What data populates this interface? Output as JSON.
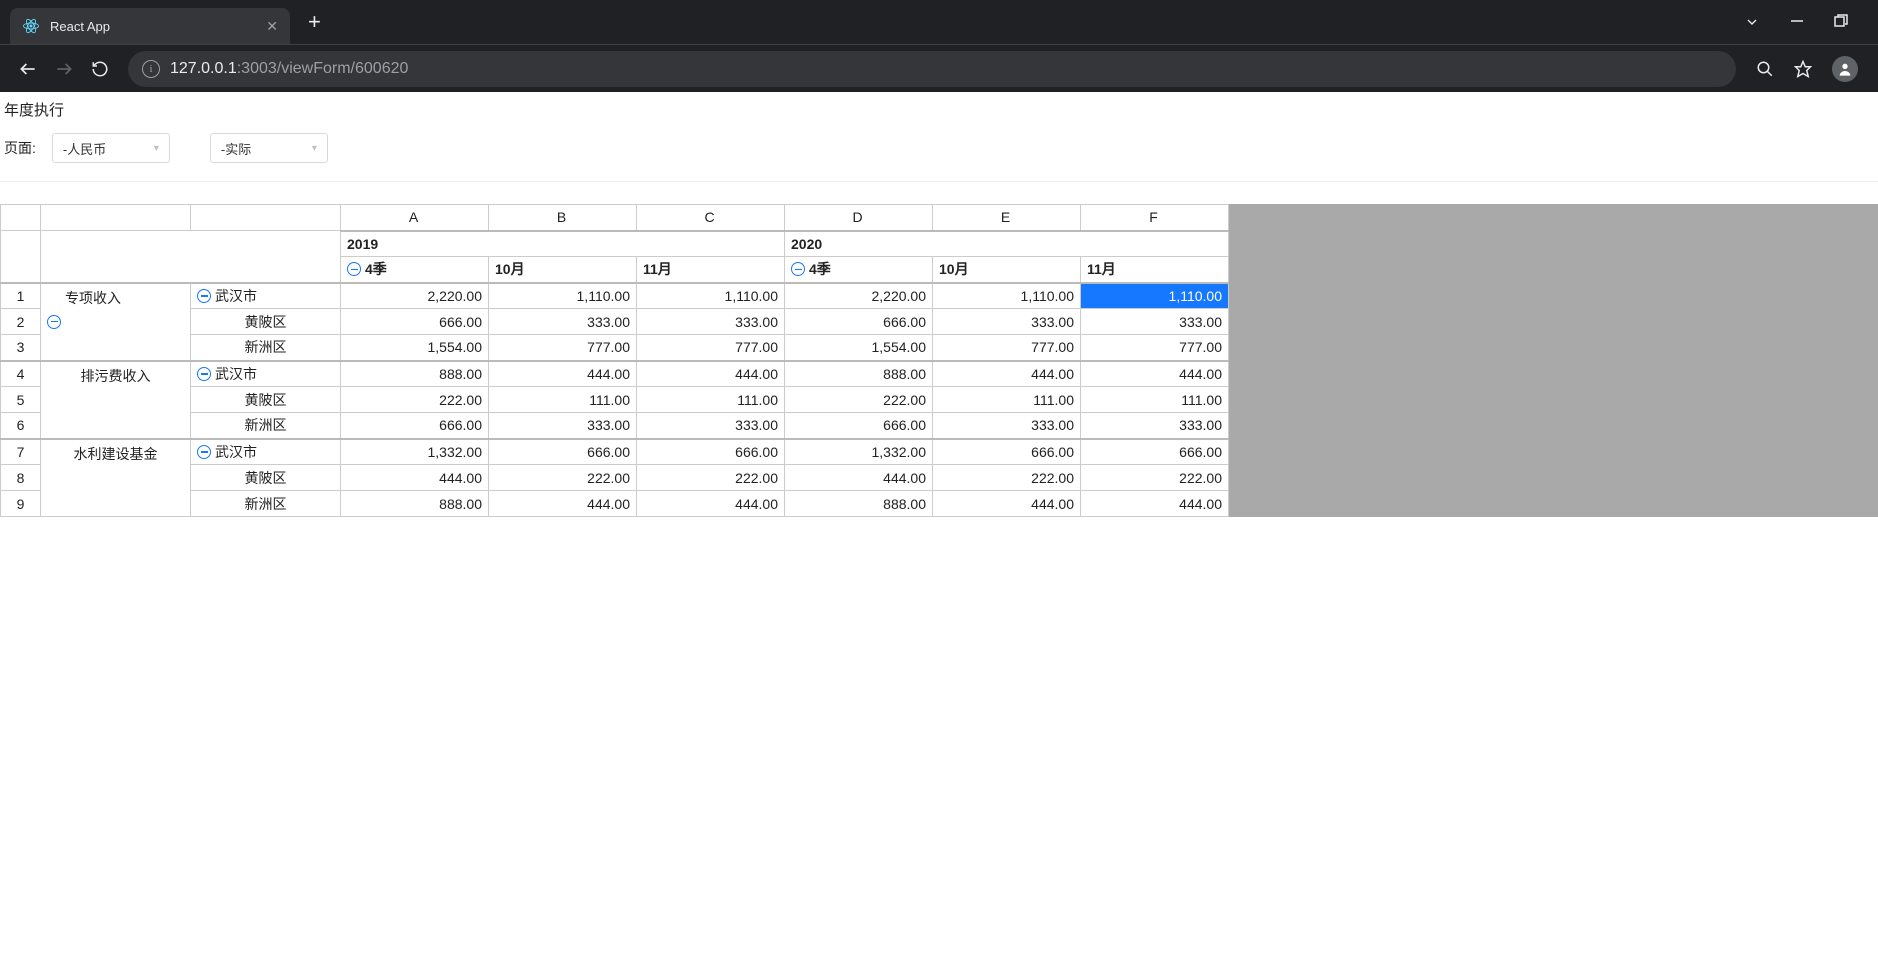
{
  "browser": {
    "tab_title": "React App",
    "url_host": "127.0.0.1",
    "url_path": ":3003/viewForm/600620"
  },
  "page": {
    "title": "年度执行",
    "page_label": "页面:",
    "select1": "-人民币",
    "select2": "-实际"
  },
  "grid": {
    "col_letters": [
      "A",
      "B",
      "C",
      "D",
      "E",
      "F"
    ],
    "years": {
      "y1": "2019",
      "y2": "2020"
    },
    "subcols": {
      "q4": "4季",
      "m10": "10月",
      "m11": "11月"
    },
    "categories": [
      {
        "name": "专项收入",
        "cities": [
          "武汉市",
          "黄陂区",
          "新洲区"
        ]
      },
      {
        "name": "排污费收入",
        "cities": [
          "武汉市",
          "黄陂区",
          "新洲区"
        ]
      },
      {
        "name": "水利建设基金",
        "cities": [
          "武汉市",
          "黄陂区",
          "新洲区"
        ]
      }
    ],
    "rows": [
      {
        "num": "1",
        "a": "2,220.00",
        "b": "1,110.00",
        "c": "1,110.00",
        "d": "2,220.00",
        "e": "1,110.00",
        "f": "1,110.00"
      },
      {
        "num": "2",
        "a": "666.00",
        "b": "333.00",
        "c": "333.00",
        "d": "666.00",
        "e": "333.00",
        "f": "333.00"
      },
      {
        "num": "3",
        "a": "1,554.00",
        "b": "777.00",
        "c": "777.00",
        "d": "1,554.00",
        "e": "777.00",
        "f": "777.00"
      },
      {
        "num": "4",
        "a": "888.00",
        "b": "444.00",
        "c": "444.00",
        "d": "888.00",
        "e": "444.00",
        "f": "444.00"
      },
      {
        "num": "5",
        "a": "222.00",
        "b": "111.00",
        "c": "111.00",
        "d": "222.00",
        "e": "111.00",
        "f": "111.00"
      },
      {
        "num": "6",
        "a": "666.00",
        "b": "333.00",
        "c": "333.00",
        "d": "666.00",
        "e": "333.00",
        "f": "333.00"
      },
      {
        "num": "7",
        "a": "1,332.00",
        "b": "666.00",
        "c": "666.00",
        "d": "1,332.00",
        "e": "666.00",
        "f": "666.00"
      },
      {
        "num": "8",
        "a": "444.00",
        "b": "222.00",
        "c": "222.00",
        "d": "444.00",
        "e": "222.00",
        "f": "222.00"
      },
      {
        "num": "9",
        "a": "888.00",
        "b": "444.00",
        "c": "444.00",
        "d": "888.00",
        "e": "444.00",
        "f": "444.00"
      }
    ]
  }
}
